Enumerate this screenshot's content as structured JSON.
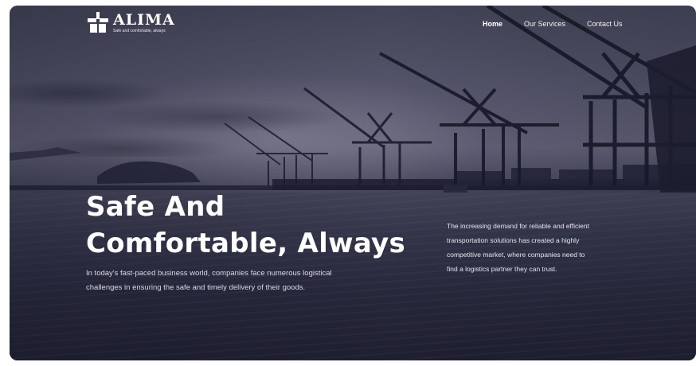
{
  "brand": {
    "name": "ALIMA",
    "tagline": "Safe and comfortable, always",
    "logo_icon": "alima-logo-icon"
  },
  "nav": {
    "items": [
      {
        "label": "Home",
        "active": true
      },
      {
        "label": "Our Services",
        "active": false
      },
      {
        "label": "Contact Us",
        "active": false
      }
    ]
  },
  "hero": {
    "title_line1": "Safe And",
    "title_line2": "Comfortable, Always",
    "description": "In today's fast-paced business world, companies face numerous logistical challenges in ensuring the safe and timely delivery of their goods.",
    "side_text": "The increasing demand for reliable and efficient transportation solutions has created a highly competitive market, where companies need to find a logistics partner they can trust."
  },
  "colors": {
    "overlay": "#2a2b45",
    "text_primary": "#ffffff",
    "text_secondary": "#d9d9e4"
  }
}
